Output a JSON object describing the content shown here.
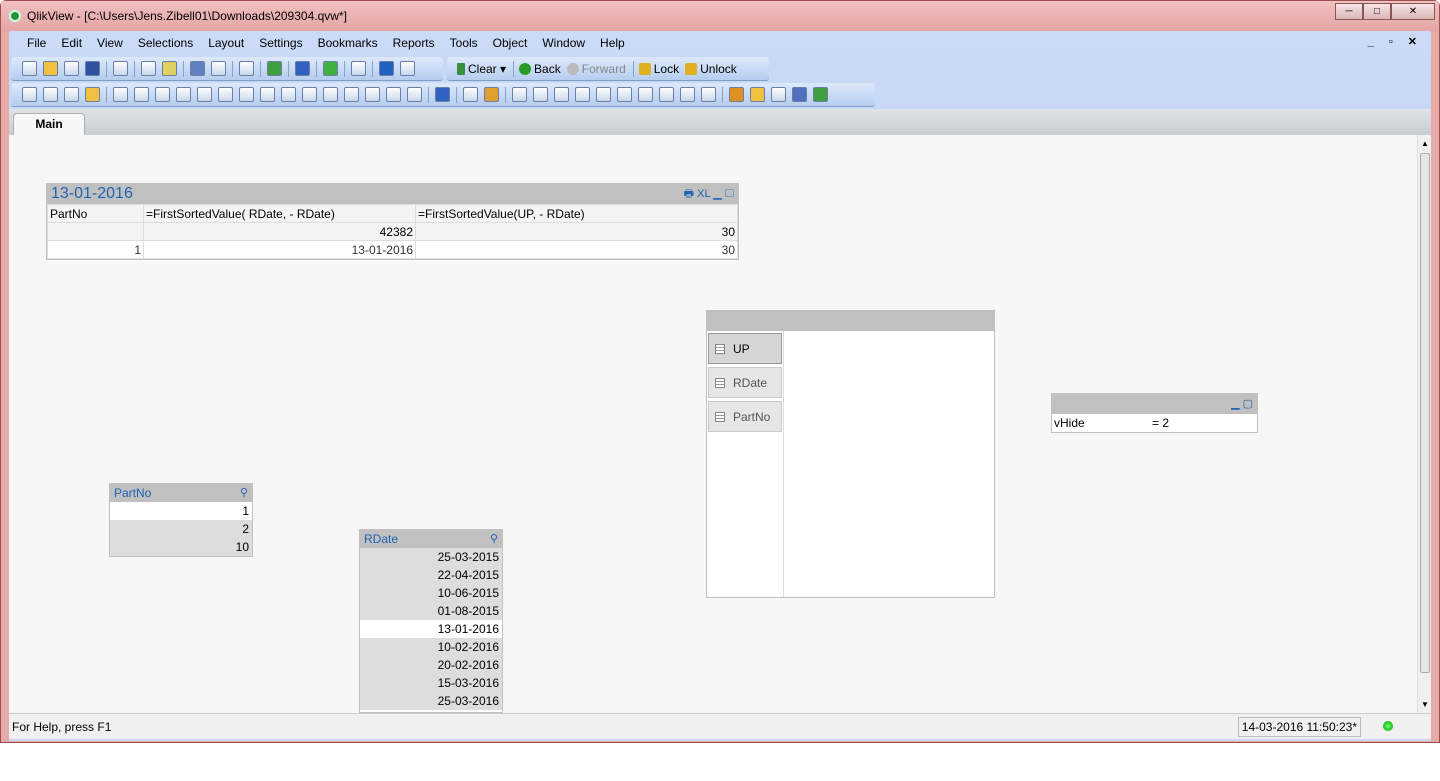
{
  "window": {
    "title": "QlikView - [C:\\Users\\Jens.Zibell01\\Downloads\\209304.qvw*]",
    "buttons": [
      "─",
      "□",
      "✕"
    ]
  },
  "menu": [
    "File",
    "Edit",
    "View",
    "Selections",
    "Layout",
    "Settings",
    "Bookmarks",
    "Reports",
    "Tools",
    "Object",
    "Window",
    "Help"
  ],
  "mdi_controls": "_ ▫ ✕",
  "toolbar1": {
    "icons": [
      "new-icon",
      "open-icon",
      "reload-icon",
      "save-icon",
      "print-icon",
      "edit-script-icon",
      "reload-data-icon",
      "undo-icon",
      "redo-icon",
      "search-icon",
      "check-icon",
      "chart-wizard-icon",
      "bookmark-star-icon",
      "edit-icon",
      "help-icon",
      "whats-this-icon"
    ]
  },
  "nav": {
    "clear": "Clear",
    "back": "Back",
    "forward": "Forward",
    "lock": "Lock",
    "unlock": "Unlock"
  },
  "toolbar2": {
    "icons": [
      "new-sheet-icon",
      "sheet-left-icon",
      "sheet-right-icon",
      "sheet-props-icon",
      "listbox-icon",
      "statistics-box-icon",
      "multibox-icon",
      "table-box-icon",
      "chart-icon",
      "input-box-icon",
      "current-selections-icon",
      "button-icon",
      "text-object-icon",
      "line-arrow-icon",
      "slider-icon",
      "bookmark-object-icon",
      "search-object-icon",
      "container-icon",
      "custom-object-icon",
      "chart-wizard-icon",
      "format-painter-icon",
      "snap-icon",
      "align-left-icon",
      "align-center-icon",
      "align-right-icon",
      "align-bottom-icon",
      "align-middle-icon",
      "align-top-icon",
      "space-horiz-icon",
      "space-vert-icon",
      "dock-icon",
      "adjust-icon",
      "user-icon",
      "doc-props-icon",
      "edit-module-icon",
      "network-icon",
      "server-icon"
    ]
  },
  "tabs": [
    "Main"
  ],
  "straight_table": {
    "caption": "13-01-2016",
    "caption_icons": "🖶 XL ▁ ▢",
    "headers": [
      "PartNo",
      "=FirstSortedValue( RDate, - RDate)",
      "=FirstSortedValue(UP, - RDate)"
    ],
    "totals": [
      "",
      "42382",
      "30"
    ],
    "rows": [
      [
        "1",
        "13-01-2016",
        "30"
      ]
    ]
  },
  "container": {
    "items": [
      "UP",
      "RDate",
      "PartNo"
    ],
    "active": "UP"
  },
  "input_box": {
    "caption_icons": "▁ ▢",
    "label": "vHide",
    "value": "= 2"
  },
  "partno_listbox": {
    "caption": "PartNo",
    "values": [
      "1",
      "2",
      "10"
    ],
    "selected": "1"
  },
  "rdate_listbox": {
    "caption": "RDate",
    "values": [
      "25-03-2015",
      "22-04-2015",
      "10-06-2015",
      "01-08-2015",
      "13-01-2016",
      "10-02-2016",
      "20-02-2016",
      "15-03-2016",
      "25-03-2016"
    ],
    "selected": "13-01-2016"
  },
  "status": {
    "help": "For Help, press F1",
    "timestamp": "14-03-2016 11:50:23*"
  }
}
